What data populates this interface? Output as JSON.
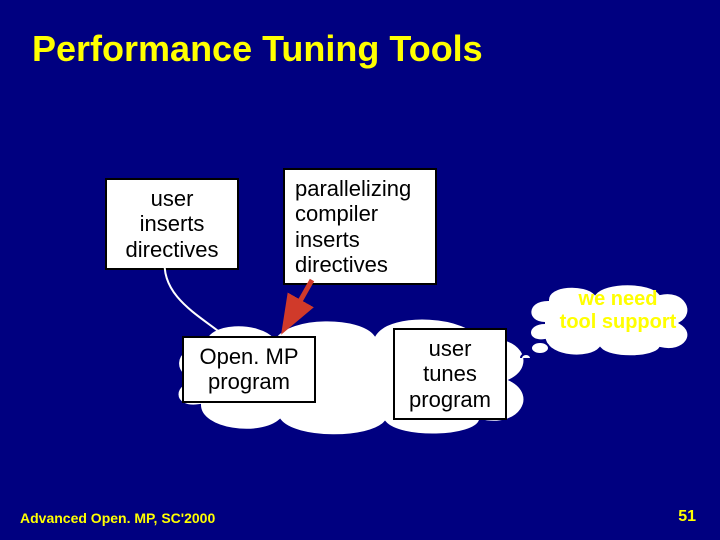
{
  "title": "Performance Tuning Tools",
  "nodes": {
    "user_inserts": "user\ninserts\ndirectives",
    "parallelizing_compiler": "parallelizing\ncompiler\ninserts\ndirectives",
    "openmp_program": "Open. MP\nprogram",
    "user_tunes": "user\ntunes\nprogram"
  },
  "callout": "we need\ntool support",
  "footer_left": "Advanced Open. MP, SC'2000",
  "footer_right": "51"
}
